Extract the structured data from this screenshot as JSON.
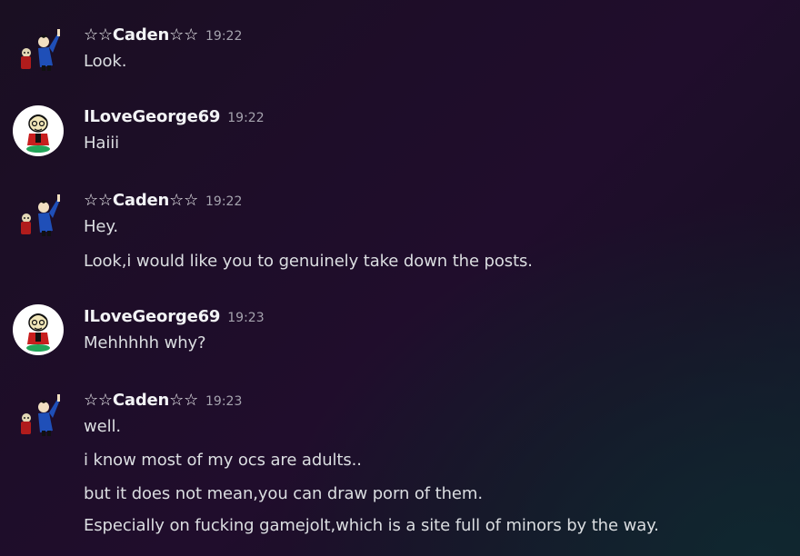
{
  "messages": [
    {
      "author": "☆☆Caden☆☆",
      "time": "19:22",
      "avatar": "caden-avatar-icon",
      "lines": [
        "Look."
      ]
    },
    {
      "author": "ILoveGeorge69",
      "time": "19:22",
      "avatar": "ilovegeorge-avatar-icon",
      "lines": [
        "Haiii"
      ]
    },
    {
      "author": "☆☆Caden☆☆",
      "time": "19:22",
      "avatar": "caden-avatar-icon",
      "lines": [
        "Hey.",
        "Look,i would like you to genuinely take down the posts."
      ]
    },
    {
      "author": "ILoveGeorge69",
      "time": "19:23",
      "avatar": "ilovegeorge-avatar-icon",
      "lines": [
        "Mehhhhh why?"
      ]
    },
    {
      "author": "☆☆Caden☆☆",
      "time": "19:23",
      "avatar": "caden-avatar-icon",
      "lines": [
        "well.",
        "i know most of my ocs are adults..",
        "but it does not mean,you can draw porn of them.",
        "Especially on fucking gamejolt,which is a site full of minors by the way."
      ]
    }
  ],
  "colors": {
    "username": "#f2f3f5",
    "timestamp": "#a5a3ae",
    "text": "#dbdee1",
    "online": "#23a55a"
  }
}
